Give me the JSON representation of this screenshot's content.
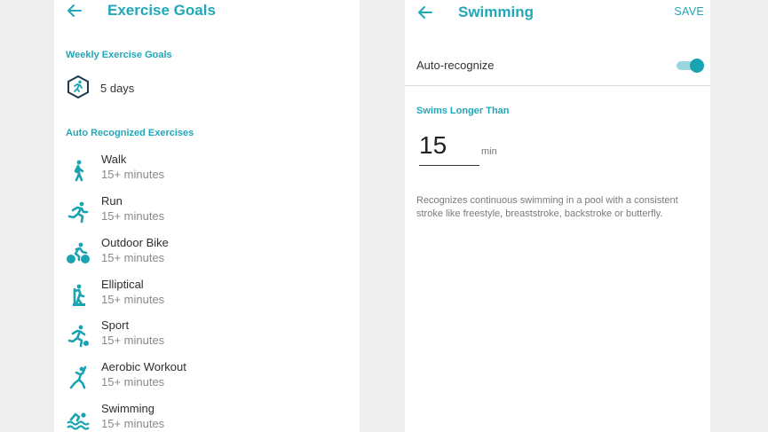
{
  "colors": {
    "accent": "#21a8b8",
    "background": "#efefef",
    "panel": "#ffffff"
  },
  "left": {
    "title": "Exercise Goals",
    "back_icon": "back-arrow-icon",
    "weekly_label": "Weekly Exercise Goals",
    "weekly_goal": {
      "icon": "runner-badge-icon",
      "value": "5 days"
    },
    "auto_label": "Auto Recognized Exercises",
    "exercises": [
      {
        "name": "Walk",
        "duration": "15+ minutes",
        "icon": "walk-icon"
      },
      {
        "name": "Run",
        "duration": "15+ minutes",
        "icon": "run-icon"
      },
      {
        "name": "Outdoor Bike",
        "duration": "15+ minutes",
        "icon": "bike-icon"
      },
      {
        "name": "Elliptical",
        "duration": "15+ minutes",
        "icon": "elliptical-icon"
      },
      {
        "name": "Sport",
        "duration": "15+ minutes",
        "icon": "sport-icon"
      },
      {
        "name": "Aerobic Workout",
        "duration": "15+ minutes",
        "icon": "aerobic-icon"
      },
      {
        "name": "Swimming",
        "duration": "15+ minutes",
        "icon": "swim-icon"
      }
    ]
  },
  "right": {
    "title": "Swimming",
    "save_label": "SAVE",
    "auto_recognize_label": "Auto-recognize",
    "auto_recognize_on": true,
    "swims_label": "Swims Longer Than",
    "minutes_value": "15",
    "unit": "min",
    "description": "Recognizes continuous swimming in a pool with a consistent stroke like freestyle, breaststroke, backstroke or butterfly."
  }
}
